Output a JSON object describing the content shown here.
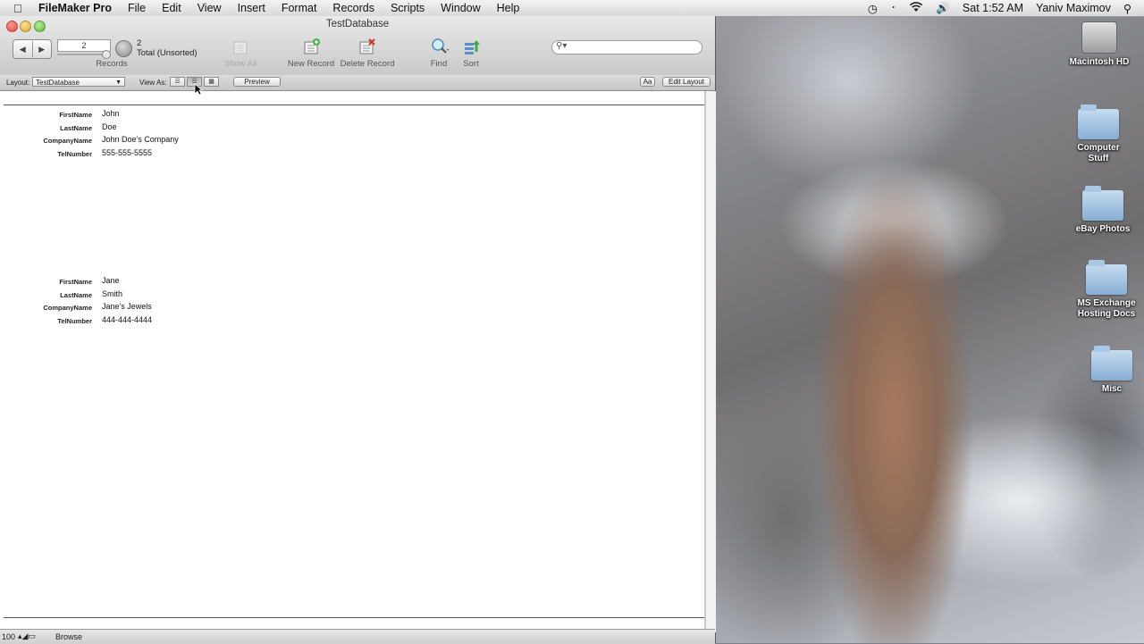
{
  "menubar": {
    "app_name": "FileMaker Pro",
    "items": [
      "File",
      "Edit",
      "View",
      "Insert",
      "Format",
      "Records",
      "Scripts",
      "Window",
      "Help"
    ],
    "clock": "Sat 1:52 AM",
    "user": "Yaniv Maximov"
  },
  "window": {
    "title": "TestDatabase"
  },
  "toolbar": {
    "record_number": "2",
    "records_label": "Records",
    "found_count": "2",
    "found_total": "Total (Unsorted)",
    "show_all_label": "Show All",
    "new_record_label": "New Record",
    "delete_record_label": "Delete Record",
    "find_label": "Find",
    "sort_label": "Sort"
  },
  "layoutbar": {
    "layout_label": "Layout:",
    "layout_value": "TestDatabase",
    "view_as_label": "View As:",
    "preview_label": "Preview",
    "font_label": "Aa",
    "edit_layout_label": "Edit Layout"
  },
  "records": [
    {
      "fields": [
        {
          "label": "FirstName",
          "value": "John"
        },
        {
          "label": "LastName",
          "value": "Doe"
        },
        {
          "label": "CompanyName",
          "value": "John Doe's Company"
        },
        {
          "label": "TelNumber",
          "value": "555-555-5555"
        }
      ]
    },
    {
      "fields": [
        {
          "label": "FirstName",
          "value": "Jane"
        },
        {
          "label": "LastName",
          "value": "Smith"
        },
        {
          "label": "CompanyName",
          "value": "Jane's Jewels"
        },
        {
          "label": "TelNumber",
          "value": "444-444-4444"
        }
      ]
    }
  ],
  "statusbar": {
    "zoom": "100",
    "mode": "Browse"
  },
  "desktop": {
    "icons": [
      {
        "label": "Macintosh HD",
        "kind": "hard-drive-icon"
      },
      {
        "label": "Computer Stuff",
        "kind": "folder-icon"
      },
      {
        "label": "eBay Photos",
        "kind": "folder-icon"
      },
      {
        "label": "MS Exchange Hosting Docs",
        "kind": "folder-icon"
      },
      {
        "label": "Misc",
        "kind": "folder-icon"
      }
    ]
  }
}
